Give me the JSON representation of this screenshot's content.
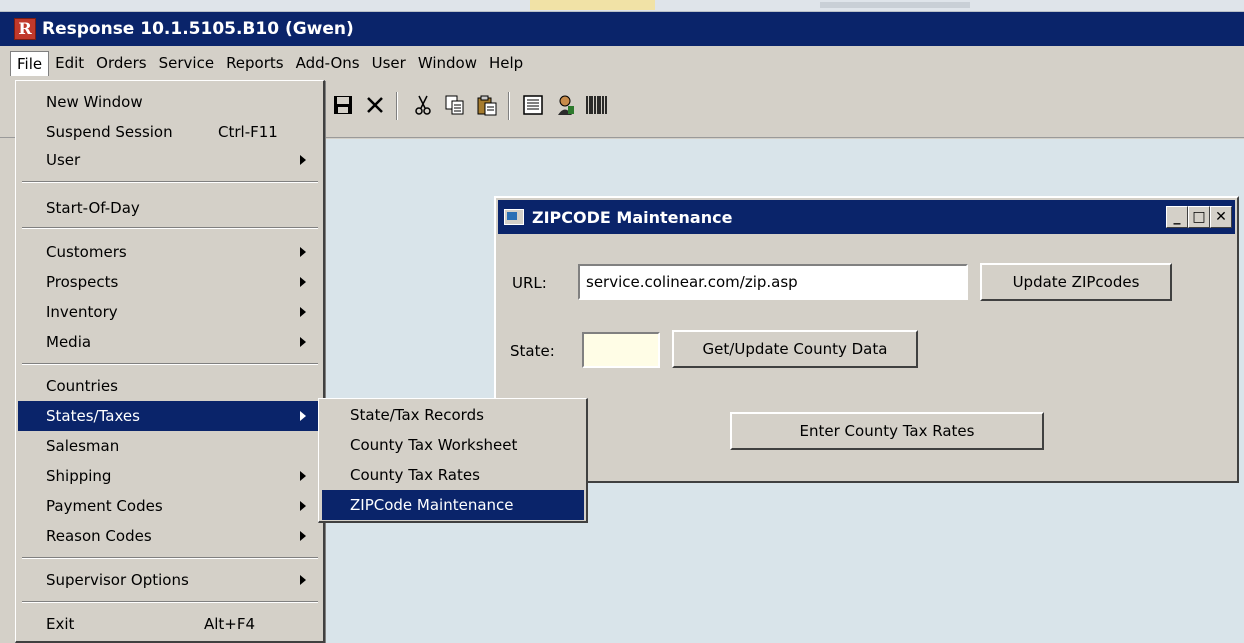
{
  "app": {
    "title": "Response 10.1.5105.B10 (Gwen)",
    "icon_letter": "R"
  },
  "menubar": [
    "File",
    "Edit",
    "Orders",
    "Service",
    "Reports",
    "Add-Ons",
    "User",
    "Window",
    "Help"
  ],
  "toolbar": {
    "icons": [
      "save-icon",
      "delete-icon",
      "cut-icon",
      "copy-icon",
      "paste-icon",
      "report-icon",
      "user-icon",
      "barcode-icon"
    ]
  },
  "file_menu": {
    "items": [
      {
        "label": "New Window"
      },
      {
        "label": "Suspend Session",
        "shortcut": "Ctrl-F11"
      },
      {
        "label": "User",
        "submenu": true
      },
      {
        "label": "Start-Of-Day"
      },
      {
        "label": "Customers",
        "submenu": true
      },
      {
        "label": "Prospects",
        "submenu": true
      },
      {
        "label": "Inventory",
        "submenu": true
      },
      {
        "label": "Media",
        "submenu": true
      },
      {
        "label": "Countries"
      },
      {
        "label": "States/Taxes",
        "submenu": true,
        "highlighted": true
      },
      {
        "label": "Salesman"
      },
      {
        "label": "Shipping",
        "submenu": true
      },
      {
        "label": "Payment Codes",
        "submenu": true
      },
      {
        "label": "Reason Codes",
        "submenu": true
      },
      {
        "label": "Supervisor Options",
        "submenu": true
      },
      {
        "label": "Exit",
        "shortcut": "Alt+F4"
      }
    ]
  },
  "states_submenu": {
    "items": [
      {
        "label": "State/Tax Records"
      },
      {
        "label": "County Tax Worksheet"
      },
      {
        "label": "County Tax Rates"
      },
      {
        "label": "ZIPCode Maintenance",
        "highlighted": true
      }
    ]
  },
  "dialog": {
    "title": "ZIPCODE Maintenance",
    "url_label": "URL:",
    "url_value": "service.colinear.com/zip.asp",
    "update_zip_button": "Update ZIPcodes",
    "state_label": "State:",
    "state_value": "",
    "county_button": "Get/Update County Data",
    "enter_rates_button": "Enter County Tax Rates"
  },
  "colors": {
    "titlebar": "#0a246a",
    "highlight": "#0a246a",
    "face": "#d4d0c8",
    "client_bg": "#d9e4ea",
    "state_field_bg": "#fffde6"
  }
}
